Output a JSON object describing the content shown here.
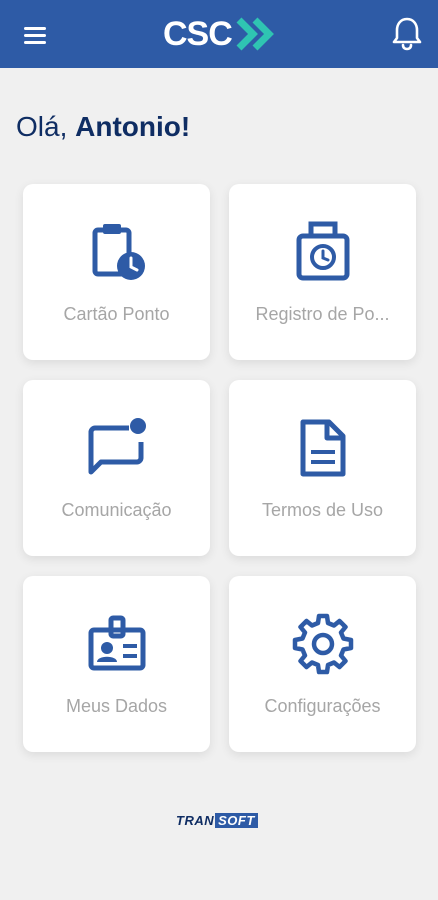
{
  "header": {
    "logo_text": "CSC",
    "menu_icon": "hamburger-menu-icon",
    "notification_icon": "bell-icon",
    "brand_color": "#2e5ba6",
    "accent_color": "#2fc4b2"
  },
  "greeting": {
    "prefix": "Olá, ",
    "name": "Antonio!"
  },
  "menu": {
    "items": [
      {
        "label": "Cartão Ponto",
        "icon": "clipboard-clock-icon"
      },
      {
        "label": "Registro de Po...",
        "icon": "time-clock-icon"
      },
      {
        "label": "Comunicação",
        "icon": "message-notification-icon"
      },
      {
        "label": "Termos de Uso",
        "icon": "document-icon"
      },
      {
        "label": "Meus Dados",
        "icon": "id-badge-icon"
      },
      {
        "label": "Configurações",
        "icon": "gear-icon"
      }
    ]
  },
  "footer": {
    "brand_part1": "TRAN",
    "brand_part2": "SOFT"
  }
}
